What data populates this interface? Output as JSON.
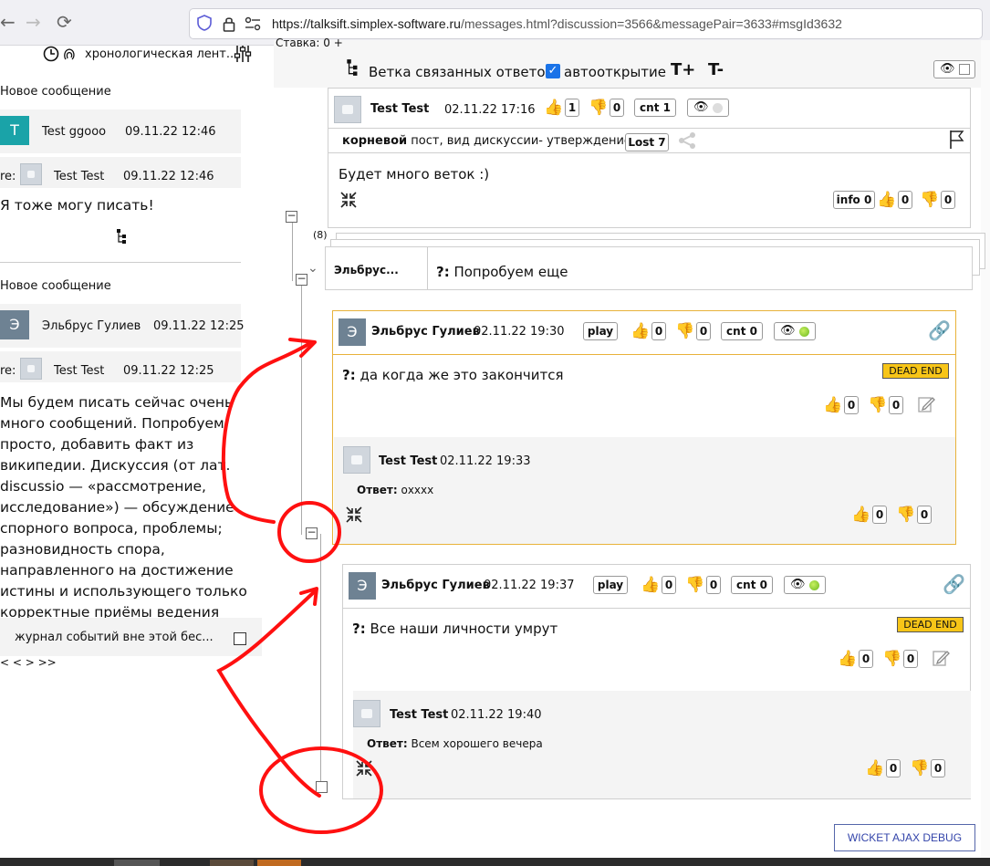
{
  "browser": {
    "url_prefix": "https://",
    "url_host": "talksift.simplex-software.ru",
    "url_path": "/messages.html?discussion=3566&messagePair=3633#msgId3632",
    "back": "←",
    "forward": "→",
    "reload": "⟳"
  },
  "left": {
    "feed_label": "хронологическая лент...",
    "sections": [
      {
        "new_label": "Новое сообщение",
        "author_letter": "T",
        "author": "Test ggooo",
        "date": "09.11.22 12:46",
        "avatar_color": "#1aa3a8",
        "re": "re:",
        "re_author": "Test Test",
        "re_date": "09.11.22 12:46",
        "body": "Я тоже могу писать!"
      },
      {
        "new_label": "Новое сообщение",
        "author_letter": "Э",
        "author": "Эльбрус Гулиев",
        "date": "09.11.22 12:25",
        "avatar_color": "#6e8293",
        "re": "re:",
        "re_author": "Test Test",
        "re_date": "09.11.22 12:25",
        "body_lines": [
          "Мы будем писать сейчас очень",
          "много сообщений. Попробуем",
          "просто, добавить факт из",
          "википедии. Дискуссия (от лат.",
          "discussio — «рассмотрение,",
          "исследование») — обсуждение",
          "спорного вопроса, проблемы;",
          "разновидность спора,",
          "направленного на достижение",
          "истины и использующего только",
          "корректные приёмы ведения"
        ]
      }
    ],
    "event_log_label": "журнал событий вне этой бес...",
    "pager": "<   <   >   >>"
  },
  "toolbar": {
    "rate_label": "Ставка: 0 +",
    "branch_label": "Ветка связанных ответов",
    "autoopen_label": "автооткрытие",
    "t_plus": "T+",
    "t_minus": "T-"
  },
  "root": {
    "author": "Test Test",
    "date": "02.11.22 17:16",
    "likes": "1",
    "dislikes": "0",
    "cnt": "cnt 1",
    "type_bold": "корневой",
    "type_rest": " пост, вид дискуссии- утверждение",
    "lost": "Lost 7",
    "text": "Будет много веток :)",
    "info": "info 0",
    "info_likes": "0",
    "info_dislikes": "0"
  },
  "branch": {
    "count": "(8)",
    "author": "Эльбрус...",
    "question_mark": "?:",
    "text": " Попробуем еще"
  },
  "msg1": {
    "letter": "Э",
    "author": "Эльбрус Гулиев",
    "date": "02.11.22 19:30",
    "play": "play",
    "likes": "0",
    "dislikes": "0",
    "cnt": "cnt 0",
    "question_mark": "?:",
    "text": " да когда же это закончится",
    "dead_end": "DEAD END",
    "body_likes": "0",
    "body_dislikes": "0",
    "reply_author": "Test Test",
    "reply_date": "02.11.22 19:33",
    "reply_label": "Ответ:",
    "reply_text": " охххх",
    "reply_likes": "0",
    "reply_dislikes": "0"
  },
  "msg2": {
    "letter": "Э",
    "author": "Эльбрус Гулиев",
    "date": "02.11.22 19:37",
    "play": "play",
    "likes": "0",
    "dislikes": "0",
    "cnt": "cnt 0",
    "question_mark": "?:",
    "text": " Все наши личности умрут",
    "dead_end": "DEAD END",
    "body_likes": "0",
    "body_dislikes": "0",
    "reply_author": "Test Test",
    "reply_date": "02.11.22 19:40",
    "reply_label": "Ответ:",
    "reply_text": " Всем хорошего вечера",
    "reply_likes": "0",
    "reply_dislikes": "0"
  },
  "debug_button": "WICKET AJAX DEBUG",
  "colors": {
    "accent_blue": "#1a73e8",
    "orange_border": "#e8b23a",
    "dead_end_yellow": "#f7c518",
    "annotation_red": "#ff1010"
  }
}
